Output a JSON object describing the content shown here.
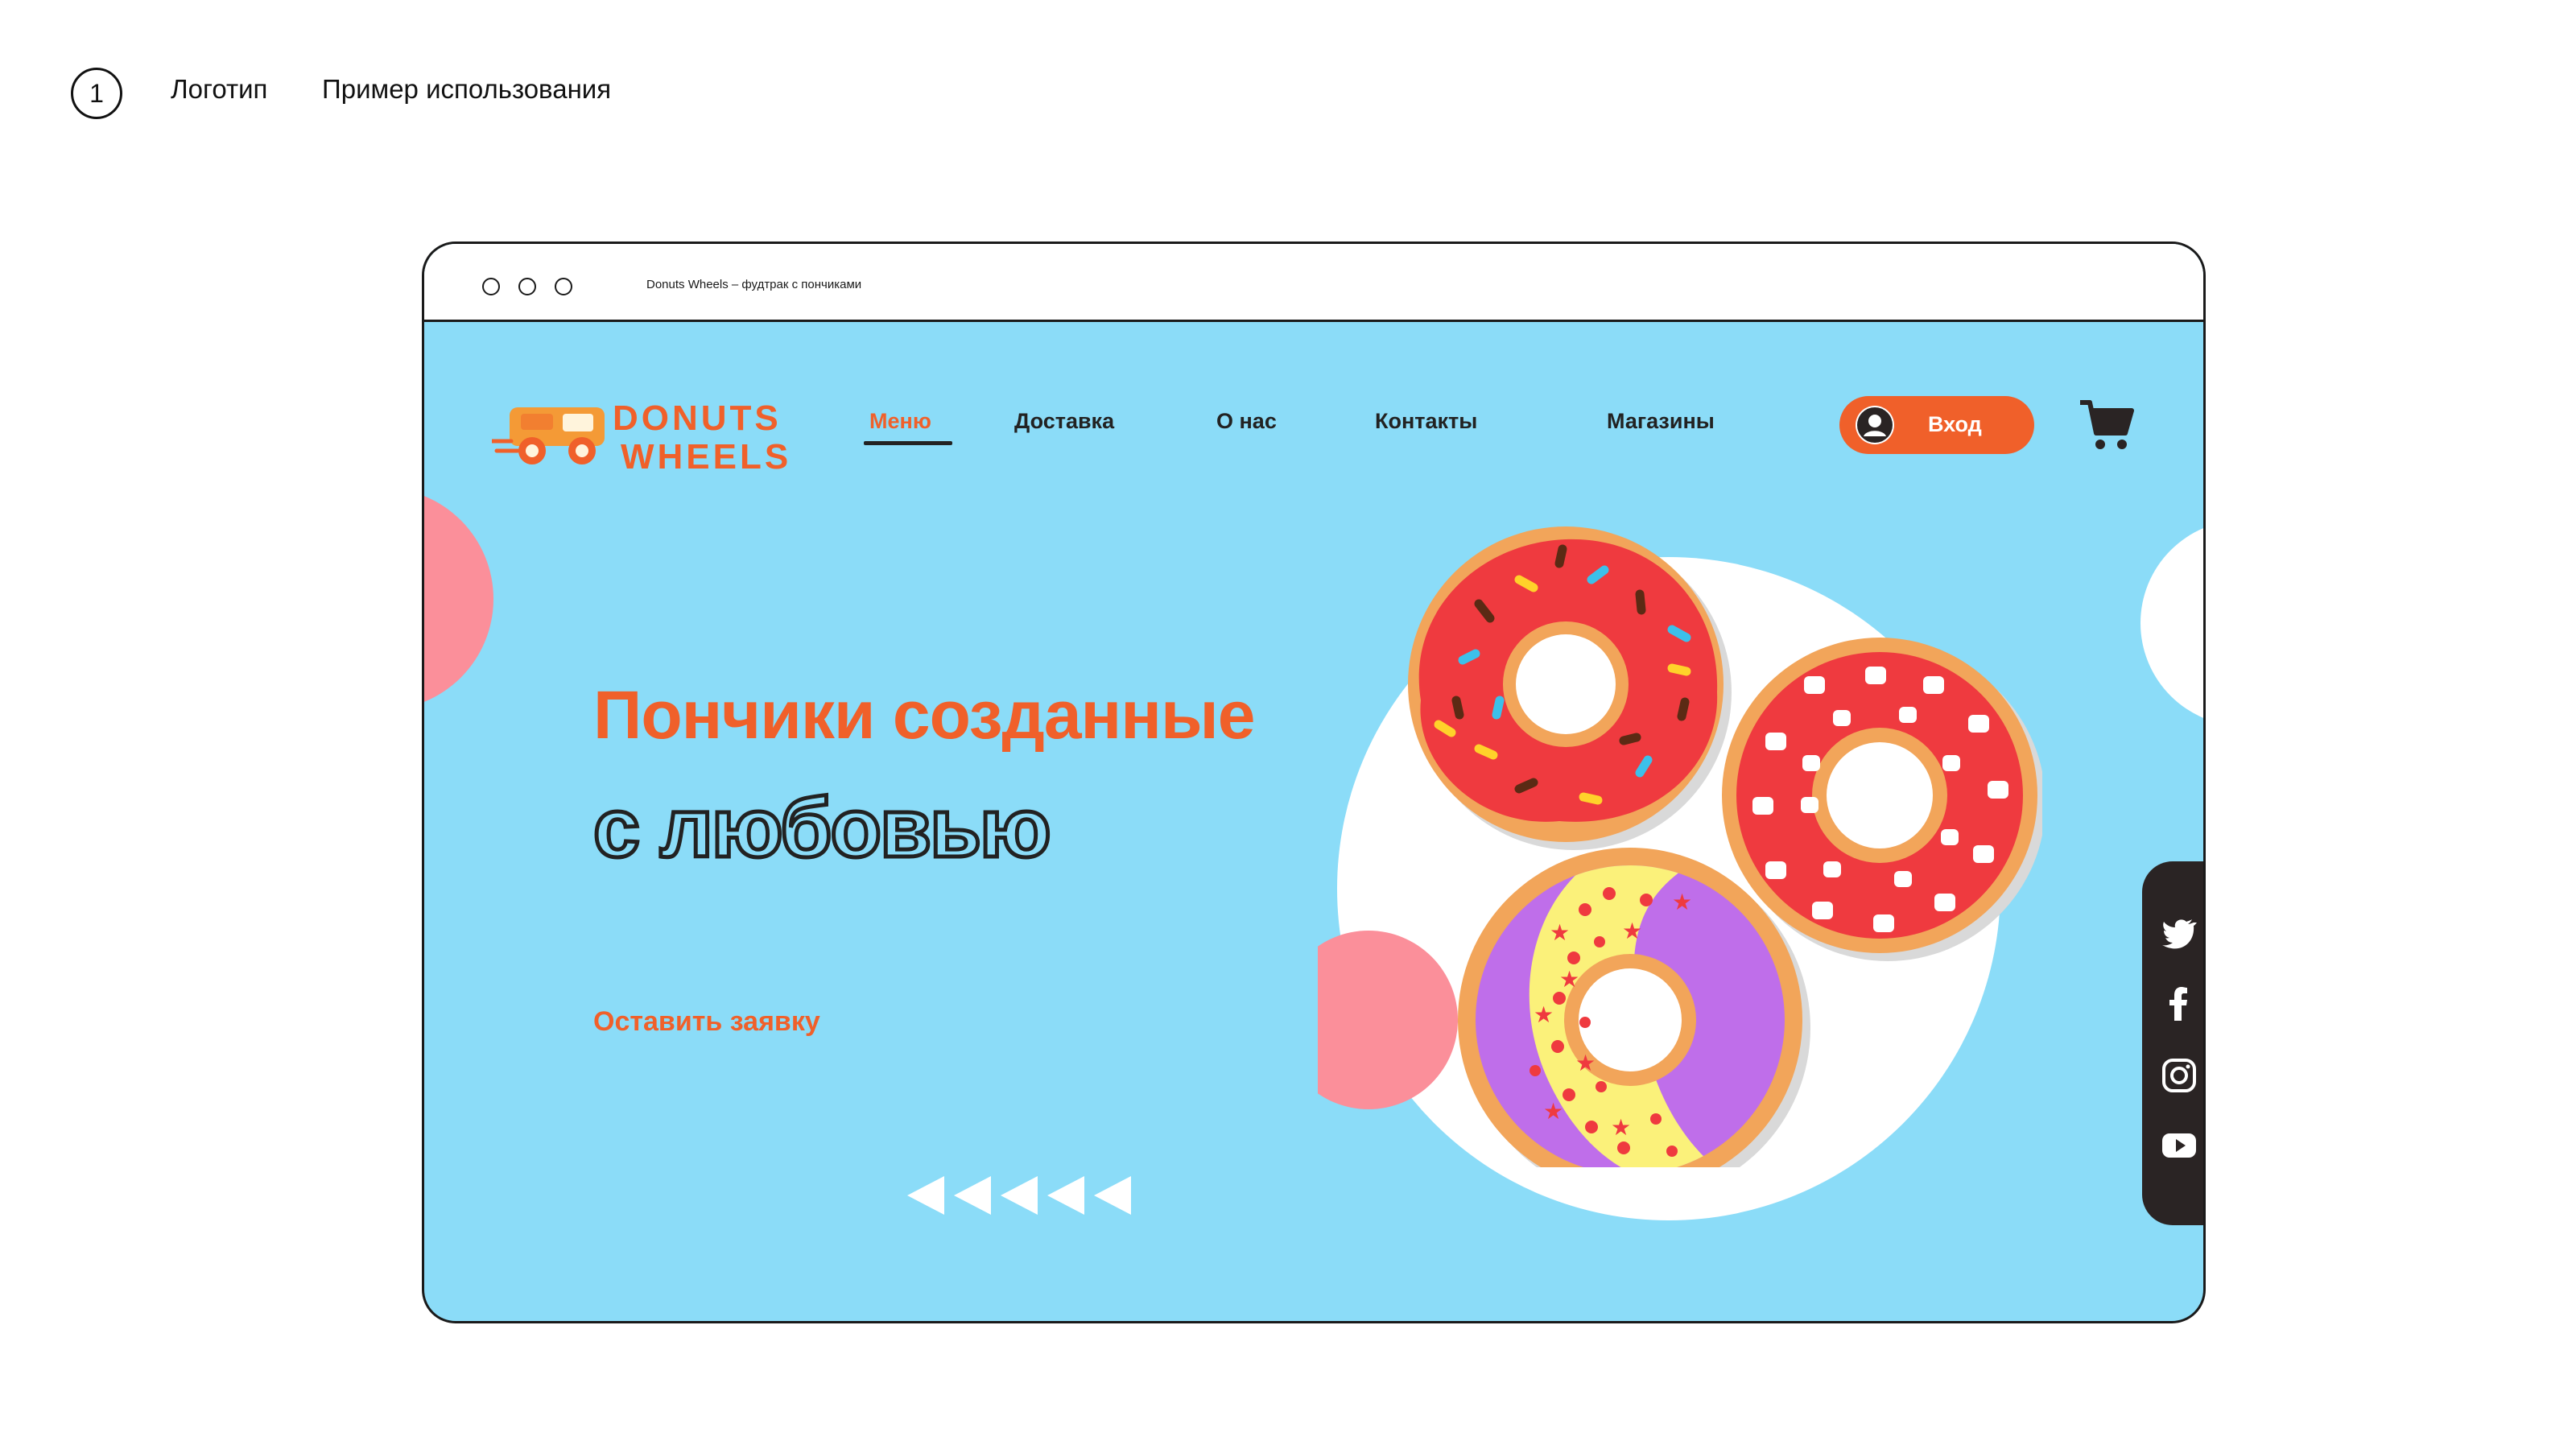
{
  "presentation": {
    "number": "1",
    "label_logo": "Логотип",
    "label_usage": "Пример использования"
  },
  "browser": {
    "tab_title": "Donuts Wheels – фудтрак с пончиками"
  },
  "logo": {
    "line1": "DONUTS",
    "line2": "WHEELS",
    "color": "#f0602a",
    "truck_color": "#f49a36"
  },
  "nav": {
    "items": [
      {
        "label": "Меню",
        "active": true
      },
      {
        "label": "Доставка",
        "active": false
      },
      {
        "label": "О нас",
        "active": false
      },
      {
        "label": "Контакты",
        "active": false
      },
      {
        "label": "Магазины",
        "active": false
      }
    ],
    "login_label": "Вход",
    "cart_icon": "shopping-cart-icon"
  },
  "hero": {
    "title_line1": "Пончики созданные",
    "title_line2": "с любовью",
    "cta": "Оставить заявку"
  },
  "social": [
    "twitter-icon",
    "facebook-icon",
    "instagram-icon",
    "youtube-icon"
  ],
  "colors": {
    "background": "#8bdcf8",
    "accent": "#f0602a",
    "pink": "#fb8f9a",
    "dark": "#2a2424"
  }
}
